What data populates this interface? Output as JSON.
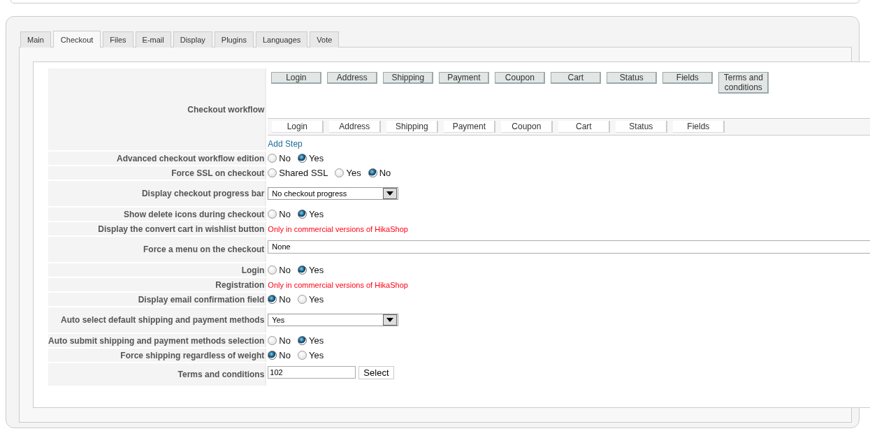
{
  "tabs": [
    {
      "label": "Main",
      "selected": false
    },
    {
      "label": "Checkout",
      "selected": true
    },
    {
      "label": "Files",
      "selected": false
    },
    {
      "label": "E-mail",
      "selected": false
    },
    {
      "label": "Display",
      "selected": false
    },
    {
      "label": "Plugins",
      "selected": false
    },
    {
      "label": "Languages",
      "selected": false
    },
    {
      "label": "Vote",
      "selected": false
    }
  ],
  "rows": [
    {
      "kind": "workflow",
      "label": "Checkout workflow",
      "available_steps": [
        "Login",
        "Address",
        "Shipping",
        "Payment",
        "Coupon",
        "Cart",
        "Status",
        "Fields",
        "Terms and conditions"
      ],
      "steps": [
        "Login",
        "Address",
        "Shipping",
        "Payment",
        "Coupon",
        "Cart",
        "Status",
        "Fields"
      ],
      "link": "Add Step"
    },
    {
      "kind": "radio",
      "label": "Advanced checkout workflow edition",
      "options": [
        {
          "label": "No",
          "selected": false
        },
        {
          "label": "Yes",
          "selected": true
        }
      ]
    },
    {
      "kind": "radio",
      "label": "Force SSL on checkout",
      "options": [
        {
          "label": "Shared SSL",
          "selected": false
        },
        {
          "label": "Yes",
          "selected": false
        },
        {
          "label": "No",
          "selected": true
        }
      ]
    },
    {
      "kind": "select",
      "label": "Display checkout progress bar",
      "value": "No checkout progress"
    },
    {
      "kind": "radio",
      "label": "Show delete icons during checkout",
      "options": [
        {
          "label": "No",
          "selected": false
        },
        {
          "label": "Yes",
          "selected": true
        }
      ]
    },
    {
      "kind": "note",
      "label": "Display the convert cart in wishlist button",
      "note": "Only in commercial versions of HikaShop"
    },
    {
      "kind": "field",
      "label": "Force a menu on the checkout",
      "value": "None"
    },
    {
      "kind": "radio",
      "label": "Login",
      "options": [
        {
          "label": "No",
          "selected": false
        },
        {
          "label": "Yes",
          "selected": true
        }
      ]
    },
    {
      "kind": "note",
      "label": "Registration",
      "note": "Only in commercial versions of HikaShop"
    },
    {
      "kind": "radio",
      "label": "Display email confirmation field",
      "options": [
        {
          "label": "No",
          "selected": true
        },
        {
          "label": "Yes",
          "selected": false
        }
      ]
    },
    {
      "kind": "select",
      "label": "Auto select default shipping and payment methods",
      "value": "Yes"
    },
    {
      "kind": "radio",
      "label": "Auto submit shipping and payment methods selection",
      "options": [
        {
          "label": "No",
          "selected": false
        },
        {
          "label": "Yes",
          "selected": true
        }
      ]
    },
    {
      "kind": "radio",
      "label": "Force shipping regardless of weight",
      "options": [
        {
          "label": "No",
          "selected": true
        },
        {
          "label": "Yes",
          "selected": false
        }
      ]
    },
    {
      "kind": "input",
      "label": "Terms and conditions",
      "value": "102",
      "button": "Select"
    }
  ]
}
